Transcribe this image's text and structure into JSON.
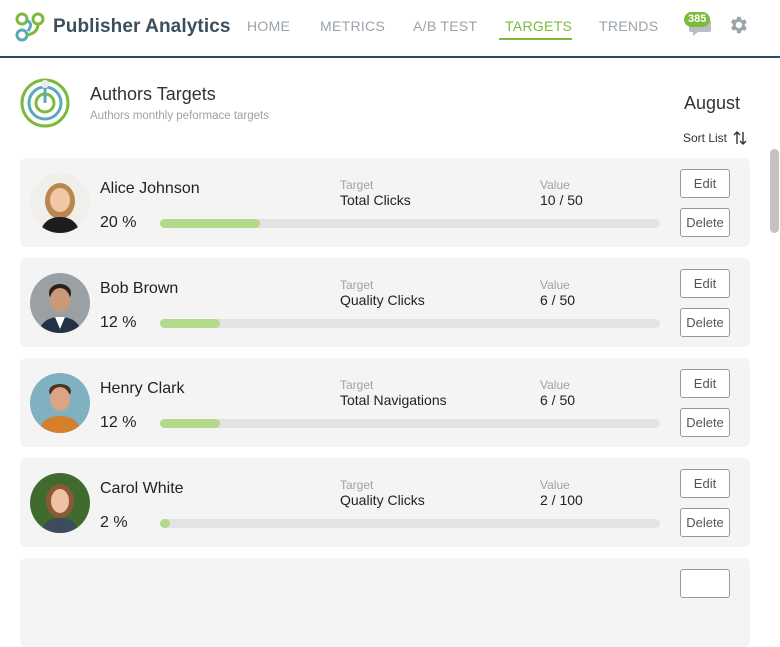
{
  "app": {
    "brand_name": "Publisher Analytics",
    "accent_color": "#7cba3d"
  },
  "nav": {
    "items": [
      {
        "label": "HOME",
        "active": false
      },
      {
        "label": "METRICS",
        "active": false
      },
      {
        "label": "A/B TEST",
        "active": false
      },
      {
        "label": "TARGETS",
        "active": true
      },
      {
        "label": "TRENDS",
        "active": false
      }
    ],
    "notification_count": "385",
    "icons": [
      "chat-icon",
      "gear-icon"
    ]
  },
  "header": {
    "title": "Authors Targets",
    "subtitle": "Authors monthly peformace targets",
    "month": "August",
    "sort_label": "Sort List"
  },
  "labels": {
    "target": "Target",
    "value": "Value",
    "edit": "Edit",
    "delete": "Delete"
  },
  "authors": [
    {
      "name": "Alice Johnson",
      "percent_text": "20 %",
      "progress": 0.2,
      "target": "Total Clicks",
      "value": "10 / 50"
    },
    {
      "name": "Bob Brown",
      "percent_text": "12 %",
      "progress": 0.12,
      "target": "Quality Clicks",
      "value": "6 / 50"
    },
    {
      "name": "Henry Clark",
      "percent_text": "12 %",
      "progress": 0.12,
      "target": "Total Navigations",
      "value": "6 / 50"
    },
    {
      "name": "Carol White",
      "percent_text": "2 %",
      "progress": 0.02,
      "target": "Quality Clicks",
      "value": "2 / 100"
    }
  ]
}
